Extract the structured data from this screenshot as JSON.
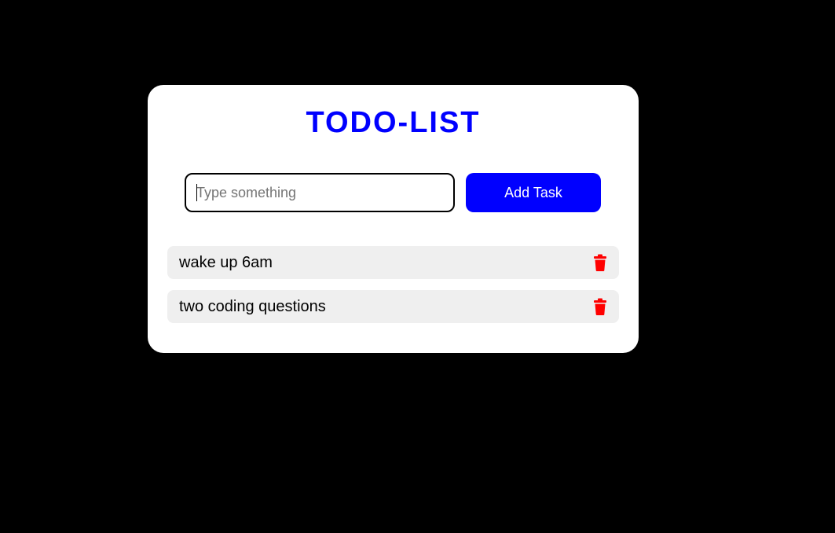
{
  "header": {
    "title": "TODO-LIST"
  },
  "input": {
    "placeholder": "Type something",
    "value": ""
  },
  "add_button": {
    "label": "Add Task"
  },
  "tasks": [
    {
      "text": "wake up 6am",
      "action_icon": "trash-icon"
    },
    {
      "text": "two coding questions",
      "action_icon": "trash-icon"
    }
  ],
  "colors": {
    "background": "#000000",
    "card": "#ffffff",
    "accent": "#0000ff",
    "task_bg": "#efefef",
    "delete": "#ff0000"
  }
}
